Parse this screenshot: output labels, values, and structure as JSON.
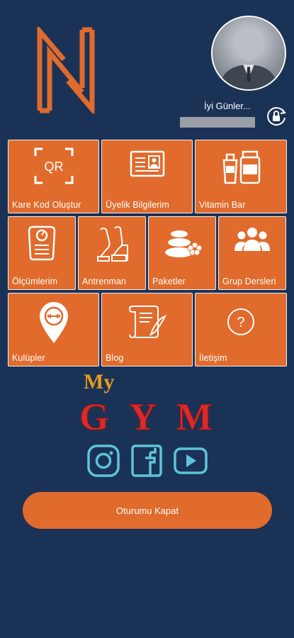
{
  "colors": {
    "background": "#1b3257",
    "accent": "#e06b2c",
    "tile_border": "#efefef",
    "social": "#5ec4d8",
    "my_text": "#e89a1a",
    "gym_text": "#d92b2b"
  },
  "header": {
    "logo_icon": "n-brand-logo-icon",
    "avatar_icon": "user-avatar-icon",
    "greeting": "İyi Günler...",
    "lock_icon": "refresh-lock-icon"
  },
  "menu": {
    "tiles": [
      {
        "label": "Kare Kod Oluştur",
        "icon": "qr-code-icon"
      },
      {
        "label": "Üyelik Bilgilerim",
        "icon": "id-card-icon"
      },
      {
        "label": "Vitamin Bar",
        "icon": "supplement-jars-icon"
      },
      {
        "label": "Ölçümlerim",
        "icon": "scale-icon"
      },
      {
        "label": "Antrenman",
        "icon": "training-icon"
      },
      {
        "label": "Paketler",
        "icon": "spa-stones-icon"
      },
      {
        "label": "Grup Dersleri",
        "icon": "group-icon"
      },
      {
        "label": "Kulüpler",
        "icon": "club-location-icon"
      },
      {
        "label": "Blog",
        "icon": "scroll-quill-icon"
      },
      {
        "label": "İletişim",
        "icon": "help-circle-icon"
      }
    ]
  },
  "brand": {
    "my": "My",
    "gym": "GYM"
  },
  "social": [
    {
      "name": "instagram",
      "icon": "instagram-icon"
    },
    {
      "name": "facebook",
      "icon": "facebook-icon"
    },
    {
      "name": "youtube",
      "icon": "youtube-icon"
    }
  ],
  "logout_label": "Oturumu Kapat"
}
